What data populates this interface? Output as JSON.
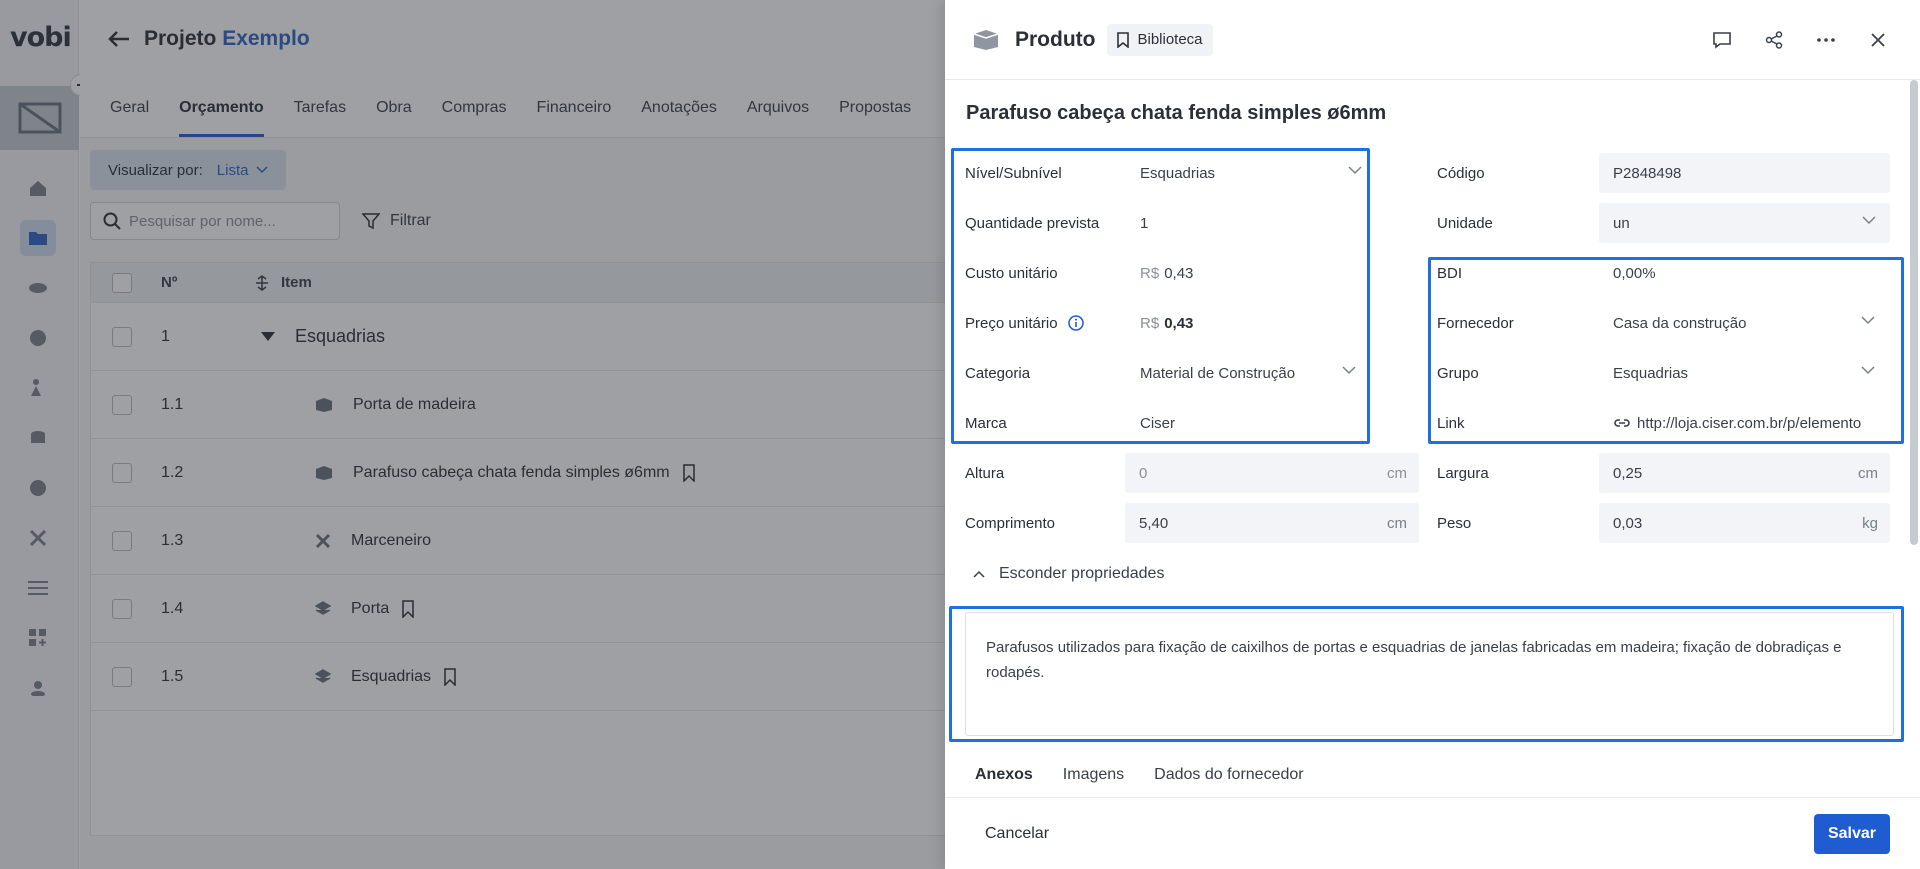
{
  "app": {
    "logo": "vobi"
  },
  "header": {
    "title_prefix": "Projeto",
    "title_highlight": "Exemplo"
  },
  "tabs": [
    "Geral",
    "Orçamento",
    "Tarefas",
    "Obra",
    "Compras",
    "Financeiro",
    "Anotações",
    "Arquivos",
    "Propostas"
  ],
  "toolbar": {
    "view_label": "Visualizar por:",
    "view_value": "Lista",
    "search_placeholder": "Pesquisar por nome...",
    "filter_label": "Filtrar"
  },
  "table": {
    "headers": {
      "num": "Nº",
      "item": "Item"
    },
    "rows": [
      {
        "num": "1",
        "name": "Esquadrias",
        "icon": "caret-down-icon",
        "level": 0
      },
      {
        "num": "1.1",
        "name": "Porta de madeira",
        "icon": "product-box-icon",
        "level": 1
      },
      {
        "num": "1.2",
        "name": "Parafuso cabeça chata fenda simples ø6mm",
        "icon": "product-box-icon",
        "level": 1,
        "bookmark": true
      },
      {
        "num": "1.3",
        "name": "Marceneiro",
        "icon": "tools-icon",
        "level": 1
      },
      {
        "num": "1.4",
        "name": "Porta",
        "icon": "layers-icon",
        "level": 1,
        "bookmark": true
      },
      {
        "num": "1.5",
        "name": "Esquadrias",
        "icon": "layers-icon",
        "level": 1,
        "bookmark": true
      }
    ]
  },
  "drawer": {
    "type_label": "Produto",
    "library_label": "Biblioteca",
    "product_title": "Parafuso cabeça chata fenda simples ø6mm",
    "fields": {
      "nivel": {
        "label": "Nível/Subnível",
        "value": "Esquadrias"
      },
      "quantidade": {
        "label": "Quantidade prevista",
        "value": "1"
      },
      "custo": {
        "label": "Custo unitário",
        "currency": "R$",
        "value": "0,43"
      },
      "preco": {
        "label": "Preço unitário",
        "currency": "R$",
        "value": "0,43"
      },
      "categoria": {
        "label": "Categoria",
        "value": "Material de Construção"
      },
      "marca": {
        "label": "Marca",
        "value": "Ciser"
      },
      "altura": {
        "label": "Altura",
        "value": "0",
        "unit": "cm"
      },
      "comprimento": {
        "label": "Comprimento",
        "value": "5,40",
        "unit": "cm"
      },
      "codigo": {
        "label": "Código",
        "value": "P2848498"
      },
      "unidade": {
        "label": "Unidade",
        "value": "un"
      },
      "bdi": {
        "label": "BDI",
        "value": "0,00%"
      },
      "fornecedor": {
        "label": "Fornecedor",
        "value": "Casa da construção"
      },
      "grupo": {
        "label": "Grupo",
        "value": "Esquadrias"
      },
      "link": {
        "label": "Link",
        "value": "http://loja.ciser.com.br/p/elemento"
      },
      "largura": {
        "label": "Largura",
        "value": "0,25",
        "unit": "cm"
      },
      "peso": {
        "label": "Peso",
        "value": "0,03",
        "unit": "kg"
      }
    },
    "toggle_properties": "Esconder propriedades",
    "description": "Parafusos utilizados para fixação de caixilhos de portas e esquadrias de janelas fabricadas em madeira; fixação de dobradiças e rodapés.",
    "subtabs": [
      "Anexos",
      "Imagens",
      "Dados do fornecedor"
    ],
    "cancel_label": "Cancelar",
    "save_label": "Salvar"
  },
  "colors": {
    "accent": "#1f5bd1",
    "highlight": "#1f6fe0",
    "link": "#2e63c7"
  }
}
